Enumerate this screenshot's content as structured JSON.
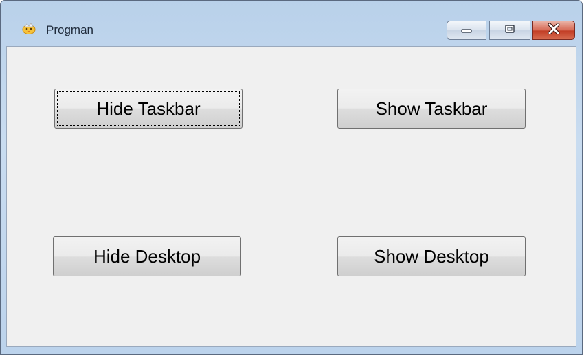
{
  "window": {
    "title": "Progman",
    "icon": "chick-icon"
  },
  "caption_buttons": {
    "minimize_icon": "minimize-icon",
    "maximize_icon": "restore-icon",
    "close_icon": "close-icon"
  },
  "buttons": {
    "hide_taskbar": "Hide Taskbar",
    "show_taskbar": "Show Taskbar",
    "hide_desktop": "Hide Desktop",
    "show_desktop": "Show Desktop"
  },
  "colors": {
    "title_bar": "#c9dcf0",
    "client_bg": "#f0f0f0",
    "close_button": "#c23e26"
  }
}
